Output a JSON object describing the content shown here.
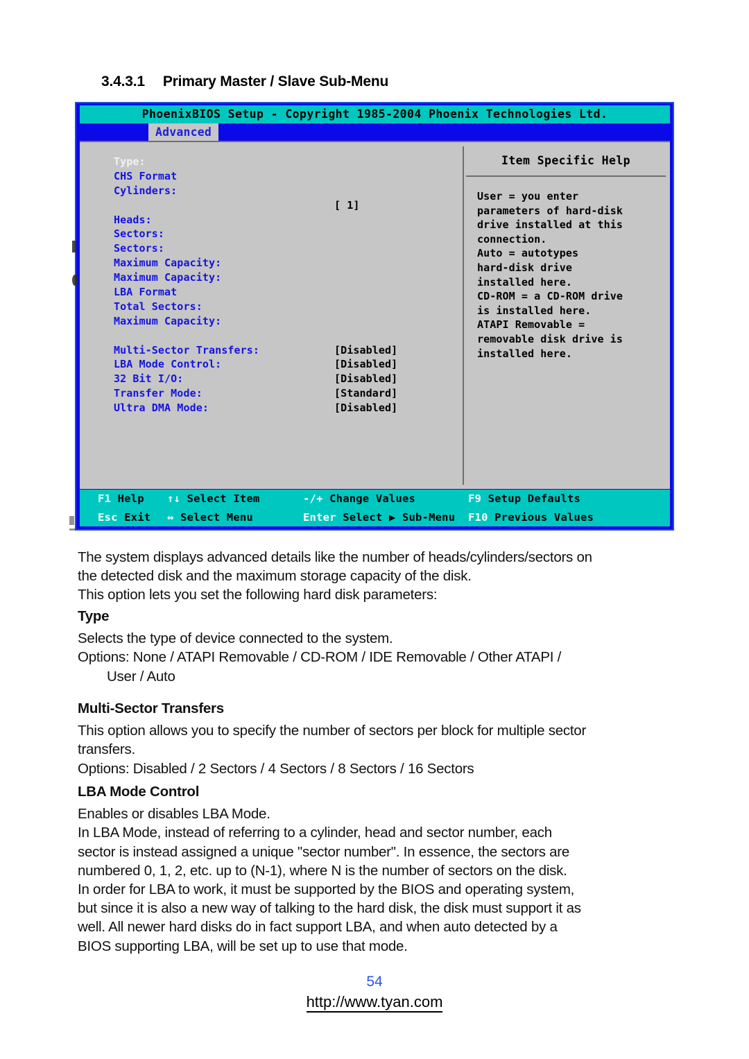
{
  "heading": {
    "number": "3.4.3.1",
    "title": "Primary Master / Slave Sub-Menu"
  },
  "bios": {
    "title": "PhoenixBIOS Setup - Copyright 1985-2004 Phoenix Technologies Ltd.",
    "active_tab": "Advanced",
    "help_title": "Item Specific Help",
    "help_lines": [
      "User = you enter",
      "parameters of hard-disk",
      "drive installed at this",
      "connection.",
      "Auto = autotypes",
      "hard-disk drive",
      "installed here.",
      "CD-ROM = a CD-ROM drive",
      "is installed here.",
      "ATAPI Removable =",
      "removable disk drive is",
      "installed here."
    ],
    "options": [
      {
        "label": "Type:",
        "value": "",
        "selected": true
      },
      {
        "label": "CHS Format",
        "value": "",
        "selected": false
      },
      {
        "label": "Cylinders:",
        "value": "",
        "selected": false
      },
      {
        "label": "",
        "value": "[   1]",
        "selected": false
      },
      {
        "label": "Heads:",
        "value": "",
        "selected": false
      },
      {
        "label": "Sectors:",
        "value": "",
        "selected": false
      },
      {
        "label": "Sectors:",
        "value": "",
        "selected": false
      },
      {
        "label": "Maximum Capacity:",
        "value": "",
        "selected": false
      },
      {
        "label": "Maximum Capacity:",
        "value": "",
        "selected": false
      },
      {
        "label": "LBA Format",
        "value": "",
        "selected": false
      },
      {
        "label": "Total Sectors:",
        "value": "",
        "selected": false
      },
      {
        "label": "Maximum Capacity:",
        "value": "",
        "selected": false
      },
      {
        "label": "",
        "value": "",
        "selected": false
      },
      {
        "label": "Multi-Sector Transfers:",
        "value": "[Disabled]",
        "selected": false
      },
      {
        "label": "LBA Mode Control:",
        "value": "[Disabled]",
        "selected": false
      },
      {
        "label": "32 Bit I/O:",
        "value": "[Disabled]",
        "selected": false
      },
      {
        "label": "Transfer Mode:",
        "value": "[Standard]",
        "selected": false
      },
      {
        "label": "Ultra DMA Mode:",
        "value": "[Disabled]",
        "selected": false
      }
    ],
    "function_keys_row1": [
      {
        "key": "F1",
        "desc": "Help"
      },
      {
        "key": "↑↓",
        "desc": "Select Item"
      },
      {
        "key": "-/+",
        "desc": "Change Values"
      },
      {
        "key": "F9",
        "desc": "Setup Defaults"
      }
    ],
    "function_keys_row2": [
      {
        "key": "Esc",
        "desc": "Exit"
      },
      {
        "key": "↔",
        "desc": "Select Menu"
      },
      {
        "key": "Enter",
        "desc": "Select ▶ Sub-Menu"
      },
      {
        "key": "F10",
        "desc": "Previous Values"
      }
    ]
  },
  "prose": {
    "intro_1": "The system displays advanced details like the number of heads/cylinders/sectors on",
    "intro_2": "the detected disk and the maximum storage capacity of the disk.",
    "intro_3": "This option lets you set the following hard disk parameters:",
    "type_heading": "Type",
    "type_desc": "Selects the type of device connected to the system.",
    "type_options_1": "Options: None / ATAPI Removable / CD-ROM / IDE Removable / Other ATAPI /",
    "type_options_2": "User / Auto",
    "mst_heading": "Multi-Sector Transfers",
    "mst_desc_1": "This option allows you to specify the number of sectors per block for multiple sector",
    "mst_desc_2": "transfers.",
    "mst_options": "Options: Disabled / 2 Sectors / 4 Sectors / 8 Sectors / 16 Sectors",
    "lba_heading": "LBA Mode Control",
    "lba_desc_1": "Enables or disables LBA Mode.",
    "lba_desc_2": "In LBA Mode, instead of referring to a cylinder, head and sector number, each",
    "lba_desc_3": "sector is instead assigned a unique \"sector number\". In essence, the sectors are",
    "lba_desc_4": "numbered 0, 1, 2, etc. up to (N-1), where N is the number of sectors on the disk.",
    "lba_desc_5": "In order for LBA to work, it must be supported by the BIOS and operating system,",
    "lba_desc_6": "but since it is also a new way of talking to the hard disk, the disk must support it as",
    "lba_desc_7": "well. All newer hard disks do in fact support LBA, and when auto detected by a",
    "lba_desc_8": "BIOS supporting LBA, will be set up to use that mode."
  },
  "footer": {
    "page_number": "54",
    "url": "http://www.tyan.com"
  }
}
